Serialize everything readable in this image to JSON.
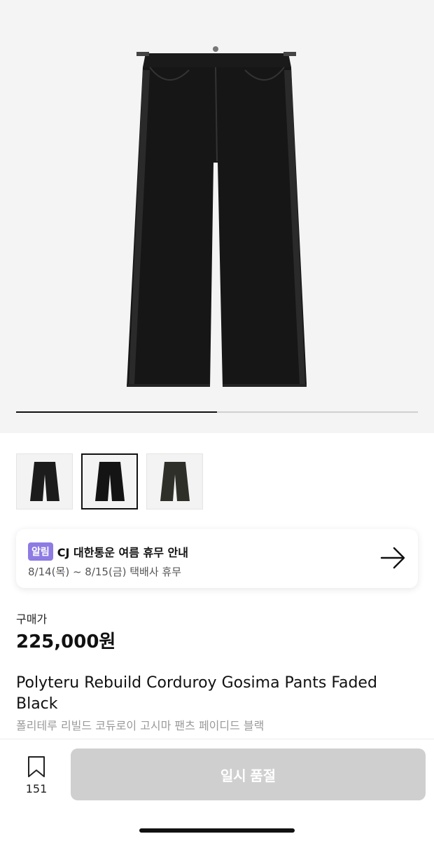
{
  "gallery": {
    "progress_fraction": 0.5,
    "thumbnails": [
      {
        "name": "thumbnail-1",
        "color": "#1c1c1c"
      },
      {
        "name": "thumbnail-2",
        "color": "#141414"
      },
      {
        "name": "thumbnail-3",
        "color": "#2f2f2a"
      }
    ],
    "active_thumbnail": 1
  },
  "notice": {
    "badge": "알림",
    "title": "CJ 대한통운 여름 휴무 안내",
    "subtitle": "8/14(목) ~ 8/15(금) 택배사 휴무",
    "icon": "arrow-right-icon"
  },
  "price": {
    "label": "구매가",
    "value": "225,000원"
  },
  "product": {
    "title": "Polyteru Rebuild Corduroy Gosima Pants Faded Black",
    "subtitle": "폴리테루 리빌드 코듀로이 고시마 팬츠 페이디드 블랙"
  },
  "bottom_bar": {
    "bookmark_icon": "bookmark-icon",
    "bookmark_count": "151",
    "cta_label": "일시 품절"
  },
  "colors": {
    "badge": "#8e7be3",
    "cta_disabled": "#cfcfcf"
  }
}
